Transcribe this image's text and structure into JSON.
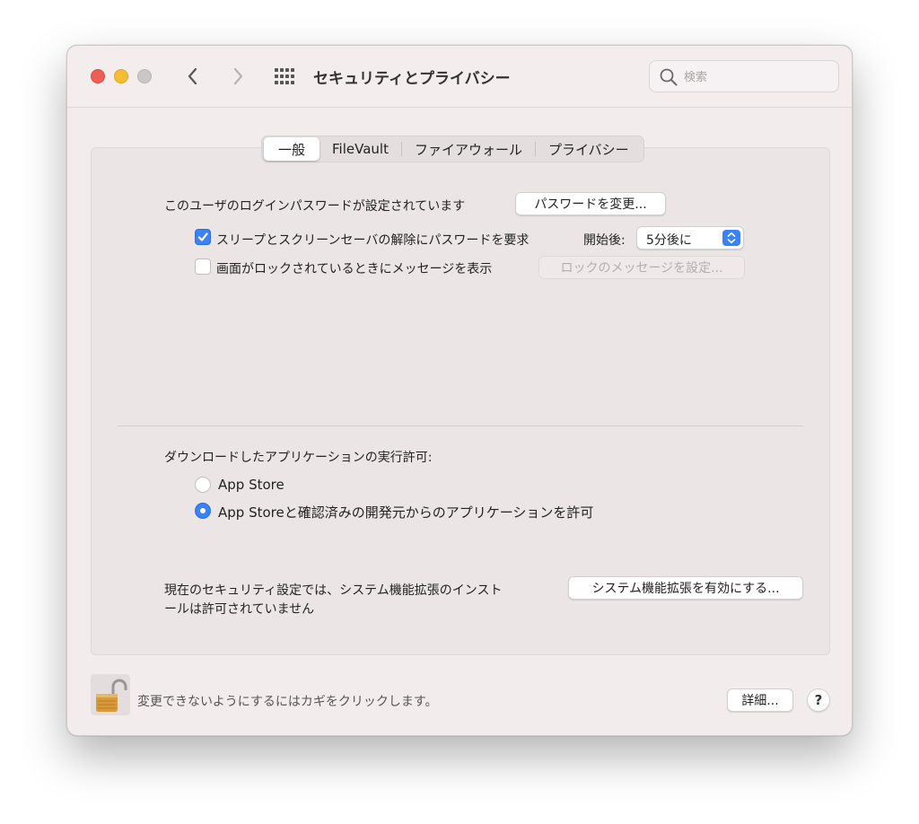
{
  "window": {
    "title": "セキュリティとプライバシー",
    "search_placeholder": "検索"
  },
  "tabs": [
    {
      "label": "一般",
      "active": true
    },
    {
      "label": "FileVault",
      "active": false
    },
    {
      "label": "ファイアウォール",
      "active": false
    },
    {
      "label": "プライバシー",
      "active": false
    }
  ],
  "general": {
    "password_set_label": "このユーザのログインパスワードが設定されています",
    "change_password_button": "パスワードを変更...",
    "require_password_label": "スリープとスクリーンセーバの解除にパスワードを要求",
    "require_password_checked": true,
    "start_after_label": "開始後:",
    "start_after_value": "5分後に",
    "lock_message_label": "画面がロックされているときにメッセージを表示",
    "lock_message_checked": false,
    "set_lock_message_button": "ロックのメッセージを設定...",
    "downloads_label": "ダウンロードしたアプリケーションの実行許可:",
    "option_app_store": "App Store",
    "option_app_store_and_identified": "App Storeと確認済みの開発元からのアプリケーションを許可",
    "selected_option": "option_app_store_and_identified",
    "extension_notice_line1": "現在のセキュリティ設定では、システム機能拡張のインスト",
    "extension_notice_line2": "ールは許可されていません",
    "enable_extensions_button": "システム機能拡張を有効にする..."
  },
  "footer": {
    "lock_text": "変更できないようにするにはカギをクリックします。",
    "advanced_button": "詳細...",
    "help_button": "?"
  },
  "colors": {
    "accent": "#3b82f6",
    "close": "#ee5e57",
    "minimize": "#f6bd32",
    "zoom_inactive": "#cbc6c7"
  }
}
